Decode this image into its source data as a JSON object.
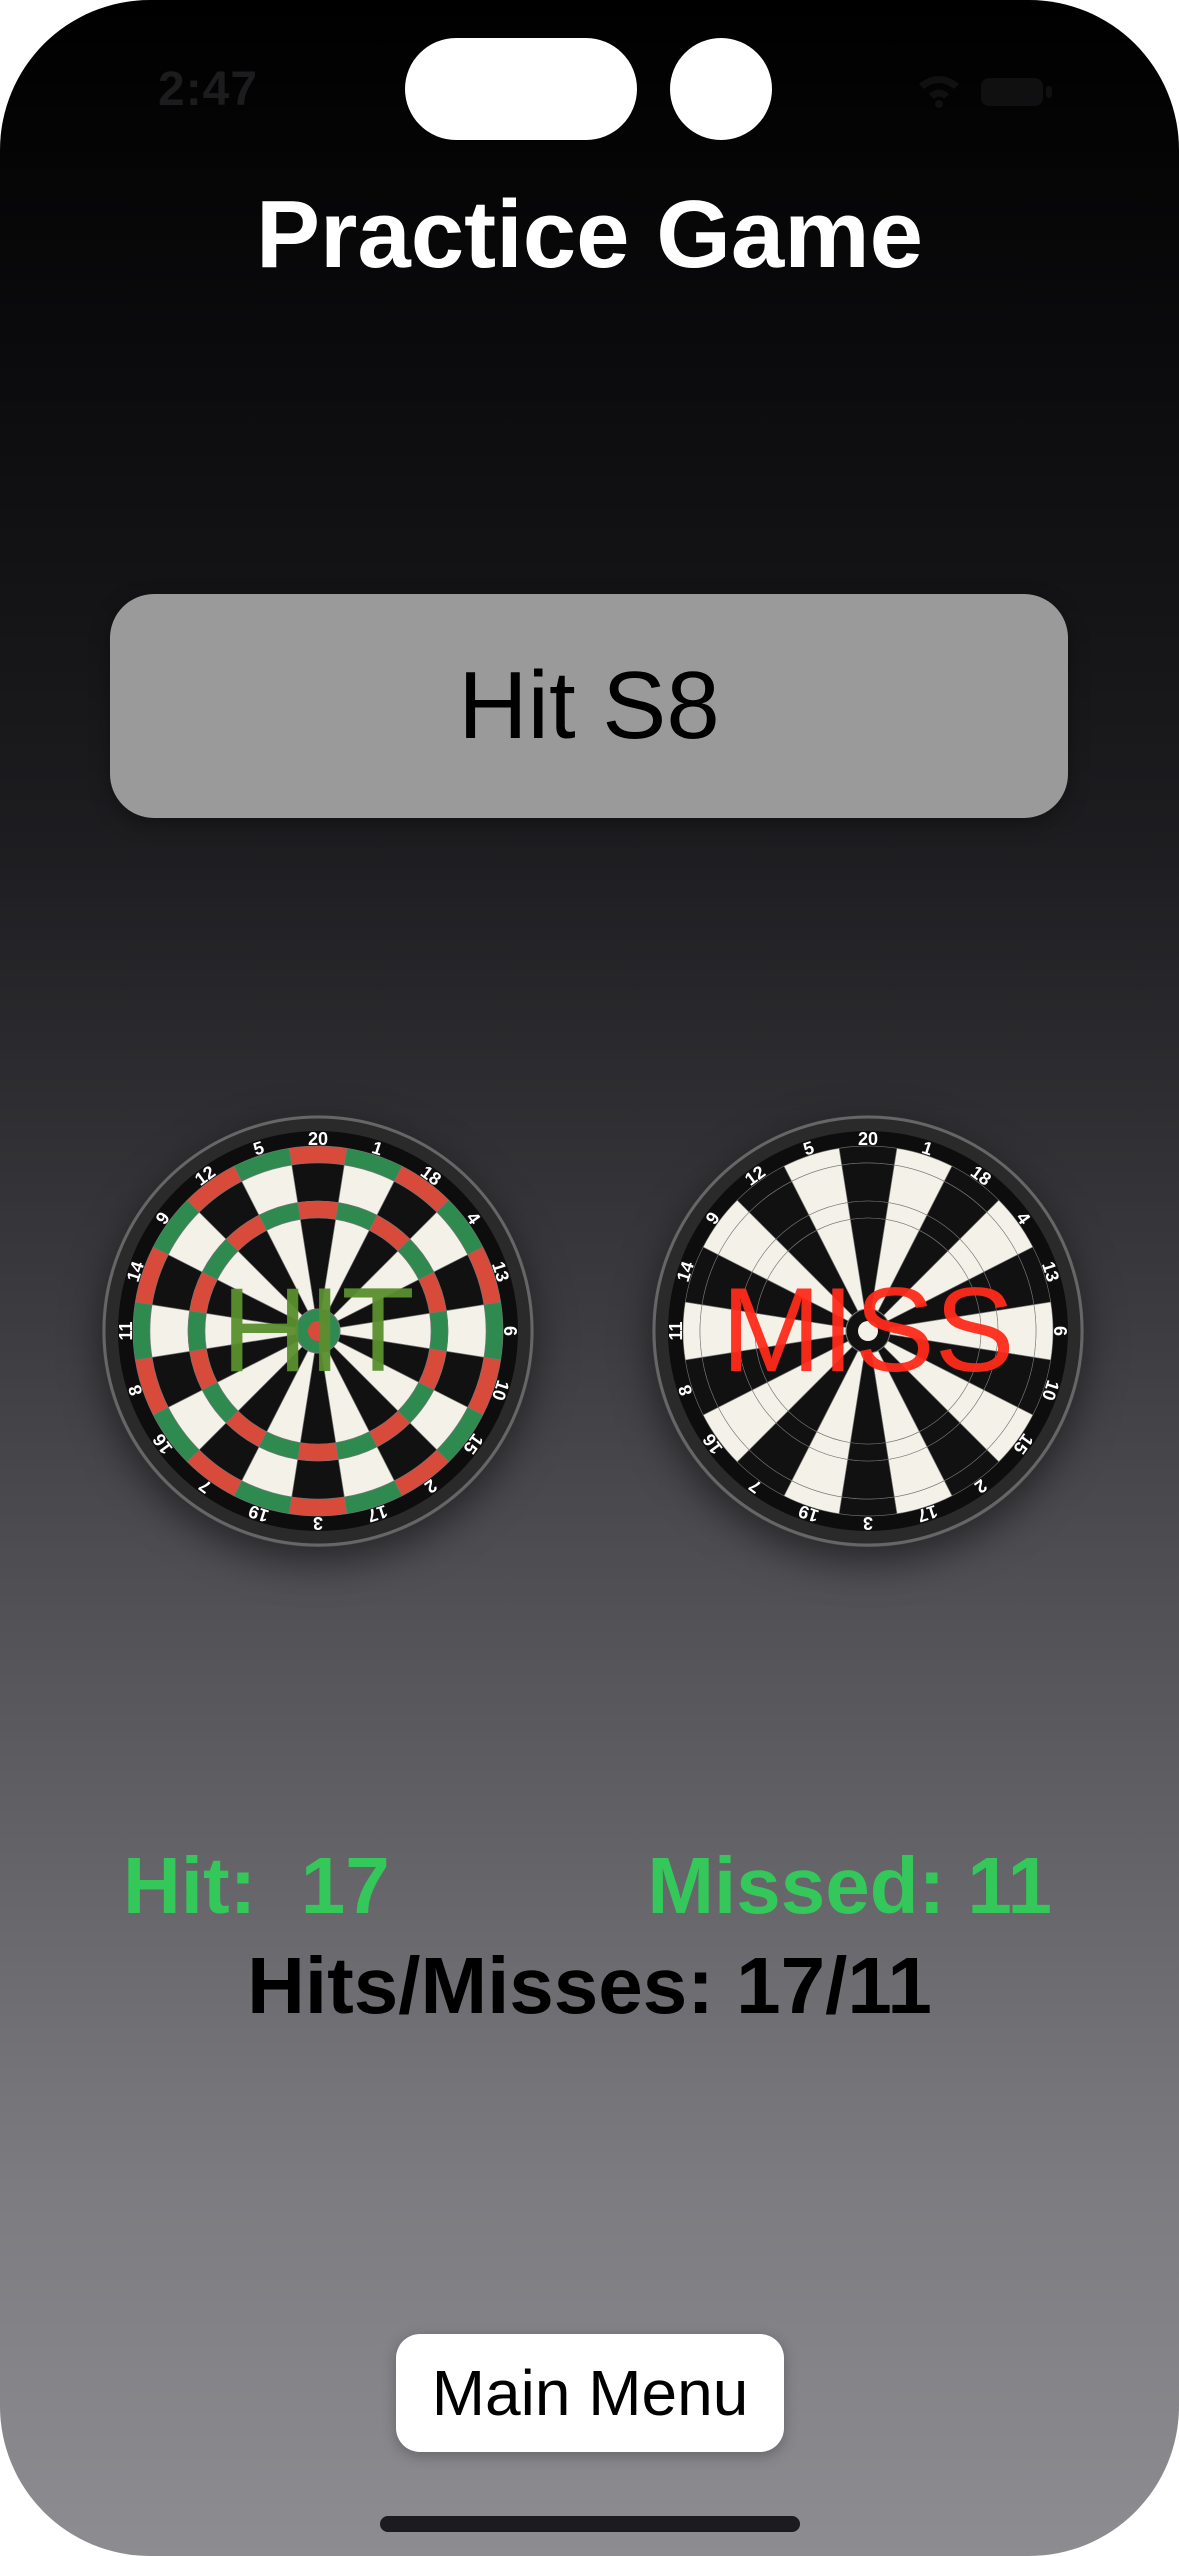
{
  "status_bar": {
    "time": "2:47"
  },
  "header": {
    "title": "Practice Game"
  },
  "target": {
    "text": "Hit S8"
  },
  "boards": {
    "numbers": [
      "20",
      "1",
      "18",
      "4",
      "13",
      "6",
      "10",
      "15",
      "2",
      "17",
      "3",
      "19",
      "7",
      "16",
      "8",
      "11",
      "14",
      "9",
      "12",
      "5"
    ],
    "hit": {
      "label": "HIT",
      "label_color": "#5a8f2e",
      "ring_colors": [
        "#d84a3a",
        "#2f8a4f"
      ]
    },
    "miss": {
      "label": "MISS",
      "label_color": "#ff2a1a",
      "ring_colors": [
        "#111111",
        "#111111"
      ]
    }
  },
  "stats": {
    "hit_text": "Hit:  17",
    "missed_text": "Missed: 11",
    "ratio_text": "Hits/Misses: 17/11",
    "accent_color": "#34c759"
  },
  "footer": {
    "main_menu_label": "Main Menu"
  }
}
